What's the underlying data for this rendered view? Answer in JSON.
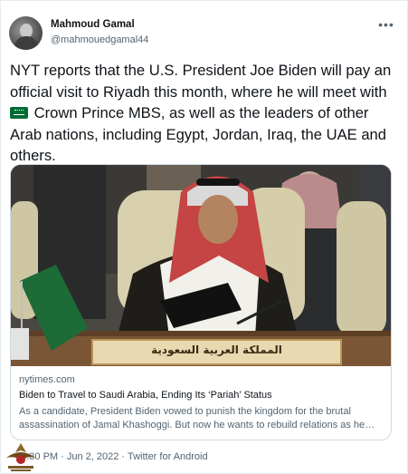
{
  "user": {
    "name": "Mahmoud Gamal",
    "handle": "@mahmouedgamal44"
  },
  "tweet": {
    "text_part1": "NYT reports that the U.S. President Joe Biden will pay an official visit to Riyadh this month, where he will meet with",
    "flag_icon": "saudi-arabia-flag",
    "text_part2": "Crown Prince MBS, as well as the leaders of other Arab nations, including Egypt, Jordan, Iraq, the UAE and others."
  },
  "card": {
    "image_caption_plaque": "المملكة العربية السعودية",
    "domain": "nytimes.com",
    "title": "Biden to Travel to Saudi Arabia, Ending Its ‘Pariah’ Status",
    "description": "As a candidate, President Biden vowed to punish the kingdom for the brutal assassination of Jamal Khashoggi. But now he wants to rebuild relations as he seeks to lower gas prices and counter Russia."
  },
  "meta": {
    "time": "10:30 PM",
    "separator1": " · ",
    "date": "Jun 2, 2022",
    "separator2": " · ",
    "client": "Twitter for Android"
  },
  "colors": {
    "text_primary": "#0f1419",
    "text_secondary": "#536471",
    "border": "#cfd9de",
    "flag_green": "#006c35"
  }
}
